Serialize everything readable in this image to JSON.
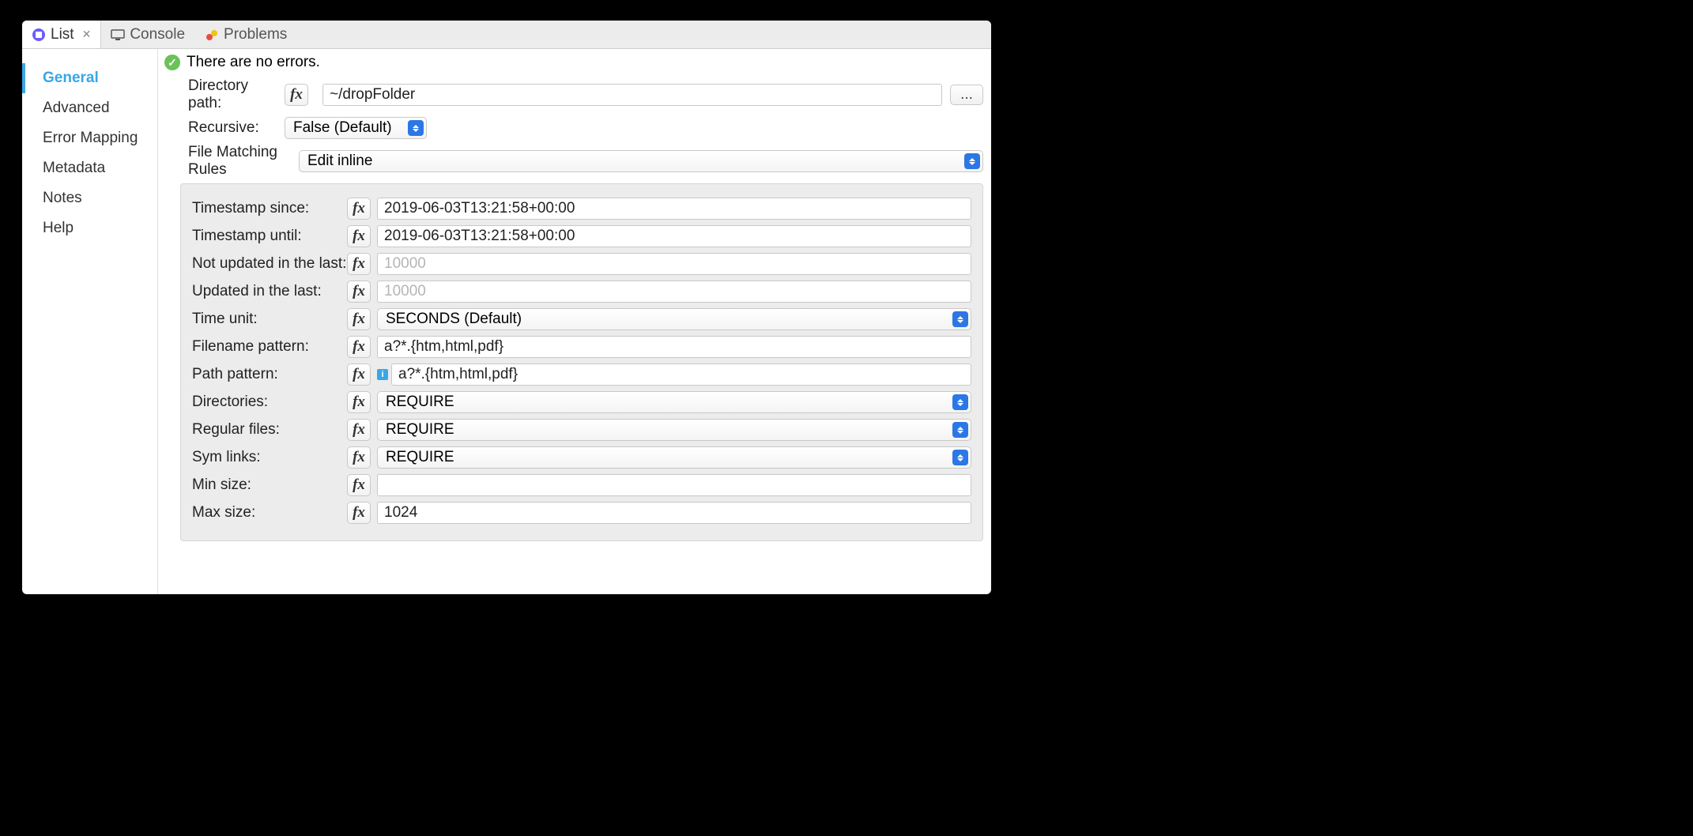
{
  "tabs": [
    {
      "label": "List",
      "active": true,
      "closable": true
    },
    {
      "label": "Console",
      "active": false,
      "closable": false
    },
    {
      "label": "Problems",
      "active": false,
      "closable": false
    }
  ],
  "sidebar": [
    {
      "label": "General",
      "active": true
    },
    {
      "label": "Advanced",
      "active": false
    },
    {
      "label": "Error Mapping",
      "active": false
    },
    {
      "label": "Metadata",
      "active": false
    },
    {
      "label": "Notes",
      "active": false
    },
    {
      "label": "Help",
      "active": false
    }
  ],
  "status_text": "There are no errors.",
  "top": {
    "directory_path_label": "Directory path:",
    "directory_path_value": "~/dropFolder",
    "browse_label": "...",
    "recursive_label": "Recursive:",
    "recursive_value": "False (Default)",
    "file_matching_label": "File Matching Rules",
    "file_matching_value": "Edit inline"
  },
  "panel": {
    "timestamp_since": {
      "label": "Timestamp since:",
      "value": "2019-06-03T13:21:58+00:00"
    },
    "timestamp_until": {
      "label": "Timestamp until:",
      "value": "2019-06-03T13:21:58+00:00"
    },
    "not_updated": {
      "label": "Not updated in the last:",
      "placeholder": "10000"
    },
    "updated": {
      "label": "Updated in the last:",
      "placeholder": "10000"
    },
    "time_unit": {
      "label": "Time unit:",
      "value": "SECONDS (Default)"
    },
    "filename_pattern": {
      "label": "Filename pattern:",
      "value": "a?*.{htm,html,pdf}"
    },
    "path_pattern": {
      "label": "Path pattern:",
      "value": "a?*.{htm,html,pdf}"
    },
    "directories": {
      "label": "Directories:",
      "value": "REQUIRE"
    },
    "regular_files": {
      "label": "Regular files:",
      "value": "REQUIRE"
    },
    "sym_links": {
      "label": "Sym links:",
      "value": "REQUIRE"
    },
    "min_size": {
      "label": "Min size:",
      "value": ""
    },
    "max_size": {
      "label": "Max size:",
      "value": "1024"
    }
  }
}
